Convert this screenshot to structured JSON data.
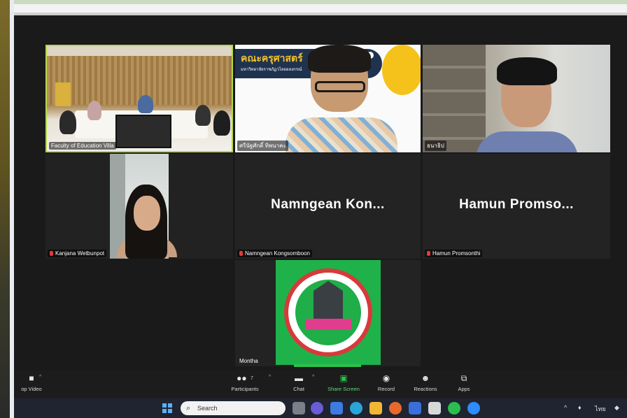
{
  "tiles": {
    "room": {
      "name": "Faculty of Education Villa"
    },
    "presenter": {
      "name": "ศรีนัฐศักดิ์ ทิพนาคะ",
      "slide_title": "คณะครุศาสตร์",
      "slide_subtitle": "มหาวิทยาลัยราชภัฏวไลยอลงกรณ์"
    },
    "office": {
      "name": "ธนาธิป"
    },
    "kanjana": {
      "name": "Kanjana Wetbunpot"
    },
    "namngean": {
      "display": "Namngean Kon...",
      "name": "Namngean Kongsomboon"
    },
    "hamun": {
      "display": "Hamun Promso...",
      "name": "Hamun Promsonthi"
    },
    "montha": {
      "name": "Montha"
    }
  },
  "toolbar": {
    "video_label": "op Video",
    "participants_label": "Participants",
    "participants_count": "7",
    "chat_label": "Chat",
    "share_label": "Share Screen",
    "record_label": "Record",
    "reactions_label": "Reactions",
    "apps_label": "Apps"
  },
  "taskbar": {
    "search_placeholder": "Search",
    "lang": "ไทย"
  },
  "colors": {
    "active_border": "#b7d84a",
    "share_green": "#2bc24a",
    "mute_red": "#e23b3b"
  },
  "icons": [
    "video-camera-icon",
    "participants-icon",
    "chat-icon",
    "share-screen-icon",
    "record-icon",
    "reactions-icon",
    "apps-icon",
    "windows-start-icon",
    "search-icon"
  ]
}
